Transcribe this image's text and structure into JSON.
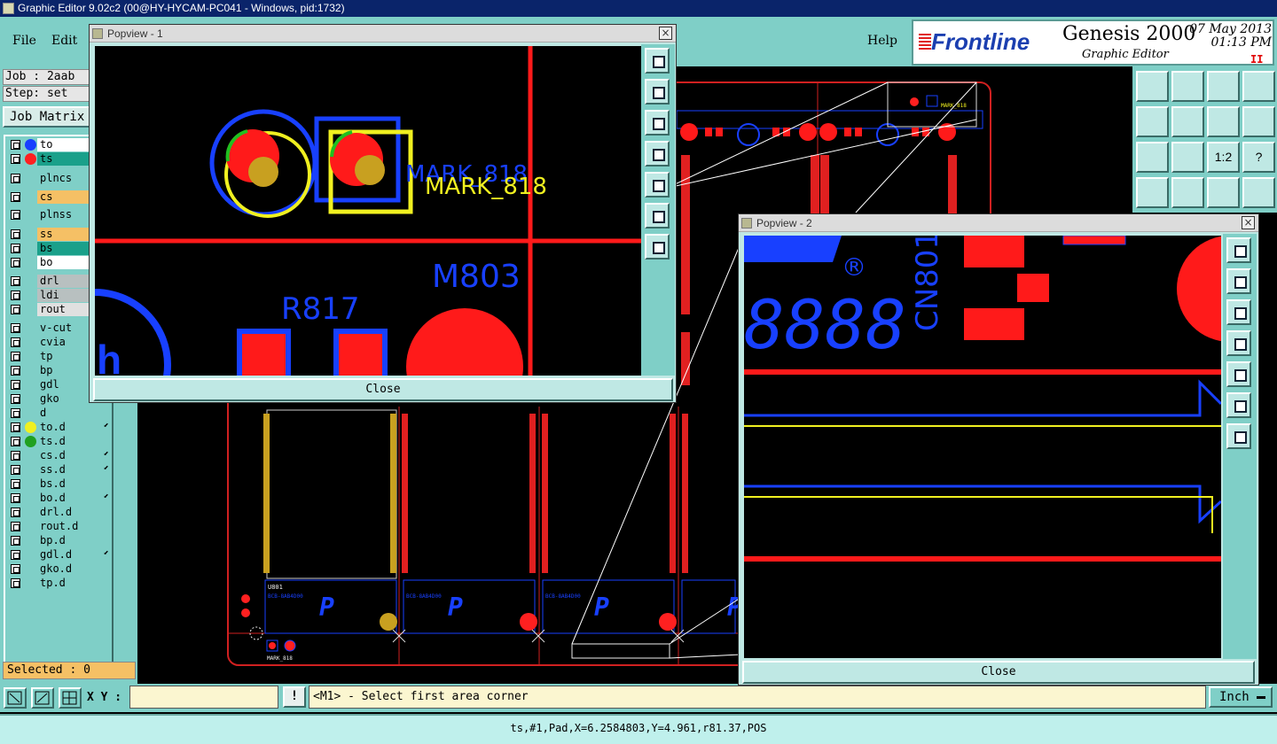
{
  "window": {
    "title": "Graphic Editor 9.02c2 (00@HY-HYCAM-PC041 - Windows, pid:1732)",
    "min": "_",
    "max": "□",
    "close": "×"
  },
  "menu": {
    "file": "File",
    "edit": "Edit",
    "help": "Help"
  },
  "brand": {
    "logo": "Frontline",
    "product": "Genesis 2000",
    "subtitle": "Graphic Editor",
    "date": "07 May 2013",
    "time": "01:13 PM",
    "pause": "II"
  },
  "job": {
    "job_line": "Job : 2aab",
    "step_line": "Step: set",
    "matrix_label": "Job Matrix"
  },
  "layers": [
    {
      "name": "to",
      "bg": "#ffffff",
      "dot": "#1840ff"
    },
    {
      "name": "ts",
      "bg": "#1aa08a",
      "dot": "#ff2020"
    },
    {
      "name": "plncs",
      "bg": "#7fcfc7",
      "dot": ""
    },
    {
      "name": "cs",
      "bg": "#f5c065",
      "dot": ""
    },
    {
      "name": "plnss",
      "bg": "#7fcfc7",
      "dot": ""
    },
    {
      "name": "ss",
      "bg": "#f5c065",
      "dot": ""
    },
    {
      "name": "bs",
      "bg": "#1aa08a",
      "dot": ""
    },
    {
      "name": "bo",
      "bg": "#ffffff",
      "dot": ""
    },
    {
      "name": "drl",
      "bg": "#b8c0c0",
      "dot": ""
    },
    {
      "name": "ldi",
      "bg": "#b8c0c0",
      "dot": ""
    },
    {
      "name": "rout",
      "bg": "#e0e0e0",
      "dot": ""
    },
    {
      "name": "v-cut",
      "bg": "#7fcfc7",
      "dot": ""
    },
    {
      "name": "cvia",
      "bg": "#7fcfc7",
      "dot": ""
    },
    {
      "name": "tp",
      "bg": "#7fcfc7",
      "dot": ""
    },
    {
      "name": "bp",
      "bg": "#7fcfc7",
      "dot": ""
    },
    {
      "name": "gdl",
      "bg": "#7fcfc7",
      "dot": ""
    },
    {
      "name": "gko",
      "bg": "#7fcfc7",
      "dot": ""
    },
    {
      "name": "d",
      "bg": "#7fcfc7",
      "dot": ""
    },
    {
      "name": "to.d",
      "bg": "#7fcfc7",
      "dot": "#f0f020",
      "flag": "⬋"
    },
    {
      "name": "ts.d",
      "bg": "#7fcfc7",
      "dot": "#20a020"
    },
    {
      "name": "cs.d",
      "bg": "#7fcfc7",
      "dot": "",
      "flag": "⬋"
    },
    {
      "name": "ss.d",
      "bg": "#7fcfc7",
      "dot": "",
      "flag": "⬋"
    },
    {
      "name": "bs.d",
      "bg": "#7fcfc7",
      "dot": ""
    },
    {
      "name": "bo.d",
      "bg": "#7fcfc7",
      "dot": "",
      "flag": "⬋"
    },
    {
      "name": "drl.d",
      "bg": "#7fcfc7",
      "dot": ""
    },
    {
      "name": "rout.d",
      "bg": "#7fcfc7",
      "dot": ""
    },
    {
      "name": "bp.d",
      "bg": "#7fcfc7",
      "dot": ""
    },
    {
      "name": "gdl.d",
      "bg": "#7fcfc7",
      "dot": "",
      "flag": "⬋"
    },
    {
      "name": "gko.d",
      "bg": "#7fcfc7",
      "dot": ""
    },
    {
      "name": "tp.d",
      "bg": "#7fcfc7",
      "dot": ""
    }
  ],
  "selected": "Selected : 0",
  "xy": {
    "label": "X Y :",
    "value": "",
    "bang": "!"
  },
  "prompt": "<M1> - Select first area corner",
  "unit": "Inch",
  "status": "ts,#1,Pad,X=6.2584803,Y=4.961,r81.37,POS",
  "right_buttons": [
    "",
    "",
    "",
    "",
    "",
    "",
    "",
    "",
    "",
    "",
    "1:2",
    "?",
    "",
    "",
    "",
    ""
  ],
  "popview1": {
    "title": "Popview - 1",
    "close_label": "Close",
    "labels": {
      "mark_blue": "MARK_818",
      "mark_yellow": "MARK_818",
      "m803": "M803",
      "r817": "R817"
    }
  },
  "popview2": {
    "title": "Popview - 2",
    "close_label": "Close",
    "labels": {
      "cn801": "CN801",
      "seg": "8888",
      "reg": "®"
    }
  },
  "board": {
    "labels": {
      "mark_small": "MARK_818",
      "u801": "U801"
    }
  }
}
